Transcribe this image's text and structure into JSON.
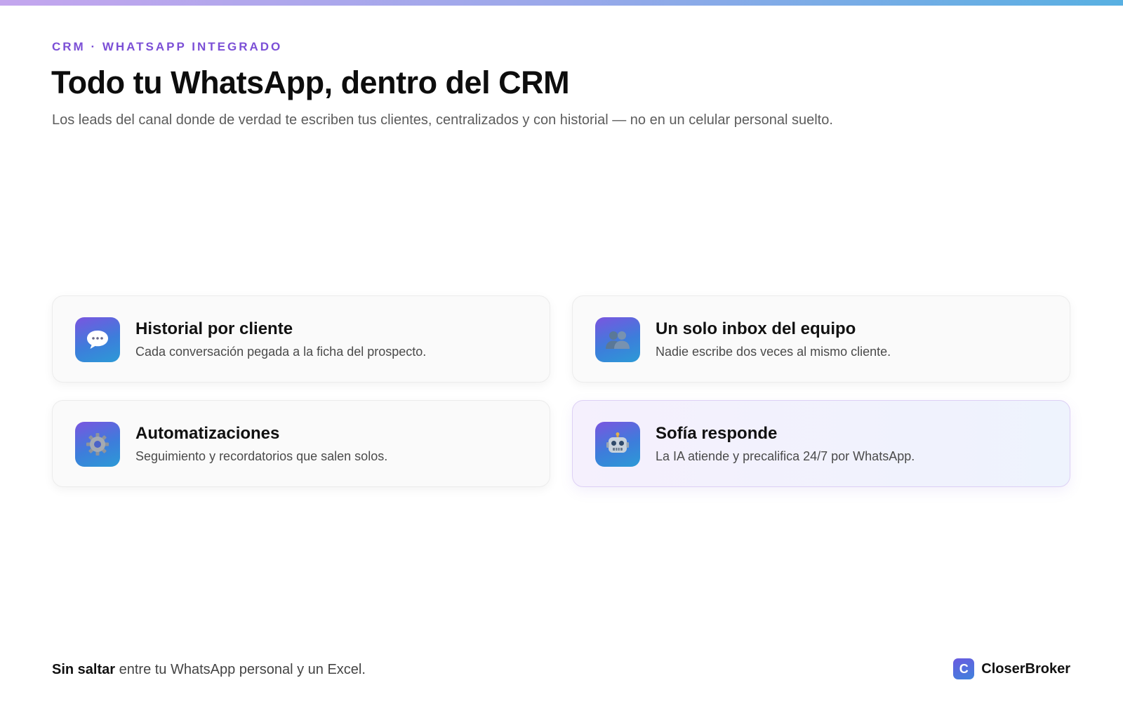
{
  "header": {
    "eyebrow": "CRM · WHATSAPP INTEGRADO",
    "title": "Todo tu WhatsApp, dentro del CRM",
    "subtitle": "Los leads del canal donde de verdad te escriben tus clientes, centralizados y con historial — no en un celular personal suelto."
  },
  "features": [
    {
      "icon": "chat-bubble-icon",
      "title": "Historial por cliente",
      "description": "Cada conversación pegada a la ficha del prospecto."
    },
    {
      "icon": "team-icon",
      "title": "Un solo inbox del equipo",
      "description": "Nadie escribe dos veces al mismo cliente."
    },
    {
      "icon": "gear-icon",
      "title": "Automatizaciones",
      "description": "Seguimiento y recordatorios que salen solos."
    },
    {
      "icon": "robot-icon",
      "title": "Sofía responde",
      "description": "La IA atiende y precalifica 24/7 por WhatsApp.",
      "highlighted": true
    }
  ],
  "footer": {
    "emphasis": "Sin saltar",
    "text": " entre tu WhatsApp personal y un Excel.",
    "brand_initial": "C",
    "brand_name": "CloserBroker"
  },
  "colors": {
    "accent": "#7b4fd6",
    "icon_gradient_start": "#7a55e0",
    "icon_gradient_end": "#2c9ad6"
  }
}
